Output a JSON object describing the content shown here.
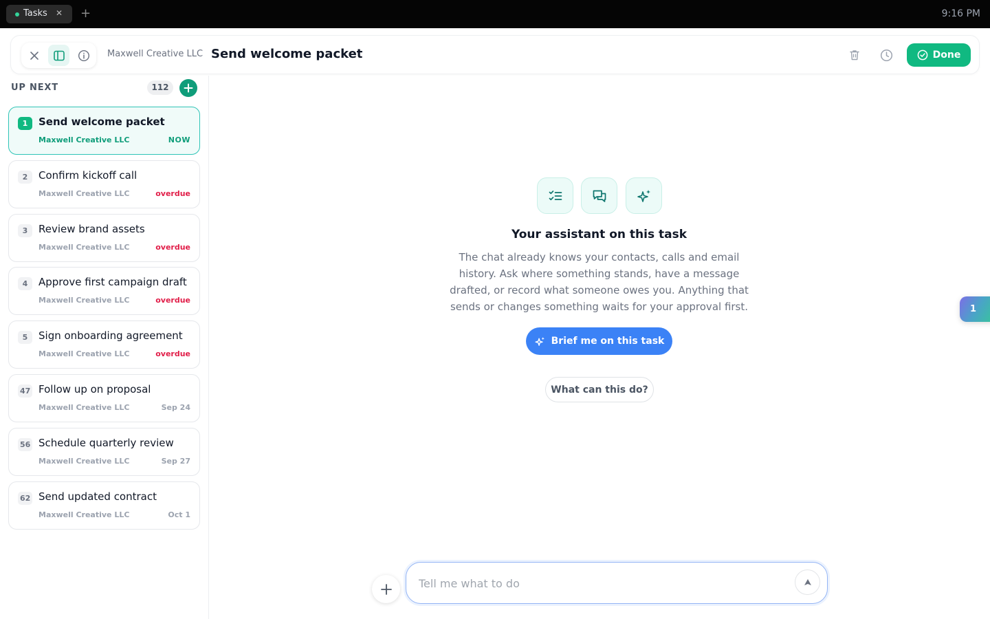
{
  "system": {
    "tab_label": "Tasks",
    "tab_close": "✕",
    "tab_add": "+",
    "clock": "9:16 PM"
  },
  "header": {
    "company": "Maxwell Creative LLC",
    "title": "Send welcome packet",
    "done_label": "Done",
    "icons": [
      "close-icon",
      "sidebar-toggle-icon",
      "info-icon",
      "trash-icon",
      "clock-icon",
      "check-circle-icon"
    ]
  },
  "sidebar": {
    "heading": "UP NEXT",
    "count": "112",
    "tasks": [
      {
        "num": "1",
        "title": "Send welcome packet",
        "company": "Maxwell Creative LLC",
        "due": "NOW",
        "status": "now"
      },
      {
        "num": "2",
        "title": "Confirm kickoff call",
        "company": "Maxwell Creative LLC",
        "due": "overdue",
        "status": "overdue"
      },
      {
        "num": "3",
        "title": "Review brand assets",
        "company": "Maxwell Creative LLC",
        "due": "overdue",
        "status": "overdue"
      },
      {
        "num": "4",
        "title": "Approve first campaign draft",
        "company": "Maxwell Creative LLC",
        "due": "overdue",
        "status": "overdue"
      },
      {
        "num": "5",
        "title": "Sign onboarding agreement",
        "company": "Maxwell Creative LLC",
        "due": "overdue",
        "status": "overdue"
      },
      {
        "num": "47",
        "title": "Follow up on proposal",
        "company": "Maxwell Creative LLC",
        "due": "Sep 24",
        "status": "date"
      },
      {
        "num": "56",
        "title": "Schedule quarterly review",
        "company": "Maxwell Creative LLC",
        "due": "Sep 27",
        "status": "date"
      },
      {
        "num": "62",
        "title": "Send updated contract",
        "company": "Maxwell Creative LLC",
        "due": "Oct 1",
        "status": "date"
      }
    ]
  },
  "assistant": {
    "feature_icons": [
      "checklist-icon",
      "chat-bubbles-icon",
      "sparkles-icon"
    ],
    "title": "Your assistant on this task",
    "description": "The chat already knows your contacts, calls and email history. Ask where something stands, have a message drafted, or record what someone owes you. Anything that sends or changes something waits for your approval first.",
    "brief_button": "Brief me on this task",
    "what_button": "What can this do?"
  },
  "side_badge": "1",
  "chat": {
    "placeholder": "Tell me what to do",
    "value": ""
  },
  "colors": {
    "accent_green": "#10b981",
    "teal": "#0f9d7a",
    "overdue": "#e11d48",
    "blue": "#3b82f6"
  }
}
